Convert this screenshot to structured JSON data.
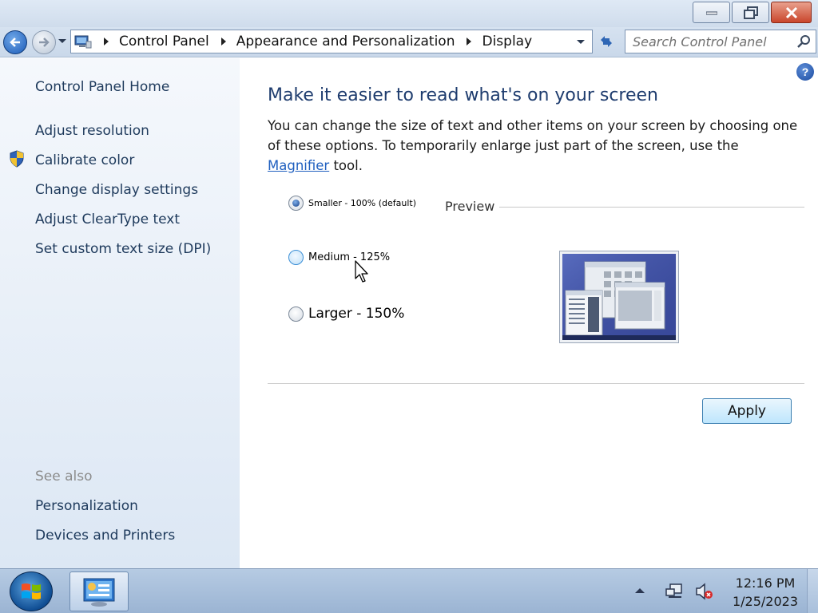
{
  "window": {
    "caption_buttons": [
      "minimize",
      "restore",
      "close"
    ]
  },
  "navbar": {
    "breadcrumbs": [
      "Control Panel",
      "Appearance and Personalization",
      "Display"
    ],
    "search_placeholder": "Search Control Panel"
  },
  "sidebar": {
    "home": "Control Panel Home",
    "links": [
      {
        "label": "Adjust resolution",
        "icon": ""
      },
      {
        "label": "Calibrate color",
        "icon": "shield-icon"
      },
      {
        "label": "Change display settings",
        "icon": ""
      },
      {
        "label": "Adjust ClearType text",
        "icon": ""
      },
      {
        "label": "Set custom text size (DPI)",
        "icon": ""
      }
    ],
    "see_also_title": "See also",
    "see_also": [
      "Personalization",
      "Devices and Printers"
    ]
  },
  "main": {
    "heading": "Make it easier to read what's on your screen",
    "description_before": "You can change the size of text and other items on your screen by choosing one of these options. To temporarily enlarge just part of the screen, use the ",
    "magnifier_link": "Magnifier",
    "description_after": " tool.",
    "options": [
      {
        "label": "Smaller - 100% (default)",
        "checked": true
      },
      {
        "label": "Medium - 125%",
        "checked": false
      },
      {
        "label": "Larger - 150%",
        "checked": false
      }
    ],
    "preview_label": "Preview",
    "apply_label": "Apply"
  },
  "taskbar": {
    "time": "12:16 PM",
    "date": "1/25/2023"
  },
  "colors": {
    "heading": "#1e3c6e",
    "link": "#1e3a5c",
    "hyperlink": "#1f5fbf"
  }
}
